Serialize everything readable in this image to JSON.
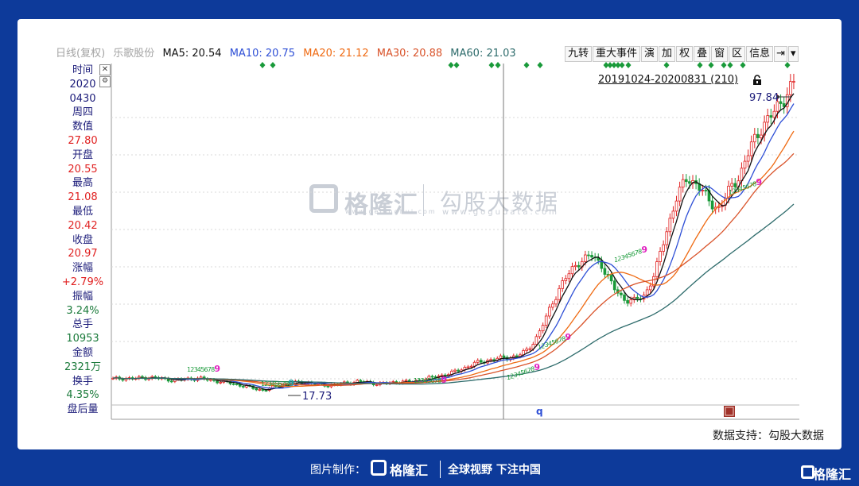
{
  "header": {
    "period": "日线(复权)",
    "stock_name": "乐歌股份",
    "ma5": "MA5: 20.54",
    "ma10": "MA10: 20.75",
    "ma20": "MA20: 21.12",
    "ma30": "MA30: 20.88",
    "ma60": "MA60: 21.03"
  },
  "toolbar": {
    "items": [
      "九转",
      "重大事件",
      "演",
      "加",
      "权",
      "叠",
      "窗",
      "区",
      "信息"
    ]
  },
  "range_label": "20191024-20200831 (210)",
  "sidebar": {
    "rows": [
      {
        "text": "时间",
        "kind": "label"
      },
      {
        "text": "2020",
        "kind": "val"
      },
      {
        "text": "0430",
        "kind": "val"
      },
      {
        "text": "周四",
        "kind": "label"
      },
      {
        "text": "数值",
        "kind": "label"
      },
      {
        "text": "27.80",
        "kind": "red"
      },
      {
        "text": "开盘",
        "kind": "label"
      },
      {
        "text": "20.55",
        "kind": "red"
      },
      {
        "text": "最高",
        "kind": "label"
      },
      {
        "text": "21.08",
        "kind": "red"
      },
      {
        "text": "最低",
        "kind": "label"
      },
      {
        "text": "20.42",
        "kind": "red"
      },
      {
        "text": "收盘",
        "kind": "label"
      },
      {
        "text": "20.97",
        "kind": "red"
      },
      {
        "text": "涨幅",
        "kind": "label"
      },
      {
        "text": "+2.79%",
        "kind": "red"
      },
      {
        "text": "振幅",
        "kind": "label"
      },
      {
        "text": "3.24%",
        "kind": "green"
      },
      {
        "text": "总手",
        "kind": "label"
      },
      {
        "text": "10953",
        "kind": "green"
      },
      {
        "text": "金额",
        "kind": "label"
      },
      {
        "text": "2321万",
        "kind": "green"
      },
      {
        "text": "换手",
        "kind": "label"
      },
      {
        "text": "4.35%",
        "kind": "green"
      },
      {
        "text": "盘后量",
        "kind": "label"
      }
    ]
  },
  "watermark": {
    "brand1": "格隆汇",
    "brand1_sub": "www.gelonghui.com",
    "brand2": "勾股大数据",
    "brand2_sub": "www.gogudata.com"
  },
  "support_text": "数据支持：勾股大数据",
  "footer": {
    "made_by": "图片制作：",
    "brand": "格隆汇",
    "slogan": "全球视野 下注中国",
    "brand_right": "格隆汇"
  },
  "colors": {
    "up": "#e02020",
    "down": "#1a9a3a",
    "ma5": "#111111",
    "ma10": "#2e4fd6",
    "ma20": "#ef6a12",
    "ma30": "#d9532a",
    "ma60": "#2d6b6b",
    "event_marker": "#1a9a3a",
    "page_bg": "#0d3a9a"
  },
  "chart_data": {
    "type": "candlestick",
    "date_range": [
      "20191024",
      "20200831"
    ],
    "bar_count": 210,
    "series": [
      {
        "name": "MA5",
        "last": 20.54
      },
      {
        "name": "MA10",
        "last": 20.75
      },
      {
        "name": "MA20",
        "last": 21.12
      },
      {
        "name": "MA30",
        "last": 20.88
      },
      {
        "name": "MA60",
        "last": 21.03
      }
    ],
    "close_trend": [
      20.6,
      20.8,
      20.7,
      21.0,
      20.9,
      20.5,
      20.3,
      20.6,
      20.8,
      20.4,
      20.0,
      19.6,
      19.0,
      18.4,
      17.73,
      18.4,
      19.2,
      19.6,
      19.8,
      19.4,
      19.0,
      19.2,
      19.6,
      20.0,
      19.7,
      19.4,
      19.6,
      20.0,
      19.8,
      20.4,
      21.0,
      21.6,
      22.3,
      23.4,
      24.6,
      25.2,
      25.8,
      26.0,
      26.5,
      28.0,
      32.0,
      38.0,
      44.0,
      48.0,
      51.0,
      52.0,
      49.5,
      44.0,
      41.0,
      40.5,
      42.0,
      48.0,
      58.0,
      67.0,
      72.0,
      70.0,
      66.0,
      64.0,
      69.0,
      73.0,
      80.0,
      85.0,
      88.0,
      92.0,
      96.0
    ],
    "annotations": {
      "min_label": "17.73",
      "max_label": "97.84",
      "crosshair_date": "20200430",
      "crosshair_value": "27.80"
    },
    "countdown_labels": [
      "1",
      "2",
      "3",
      "4",
      "5",
      "6",
      "7",
      "8",
      "9"
    ]
  }
}
